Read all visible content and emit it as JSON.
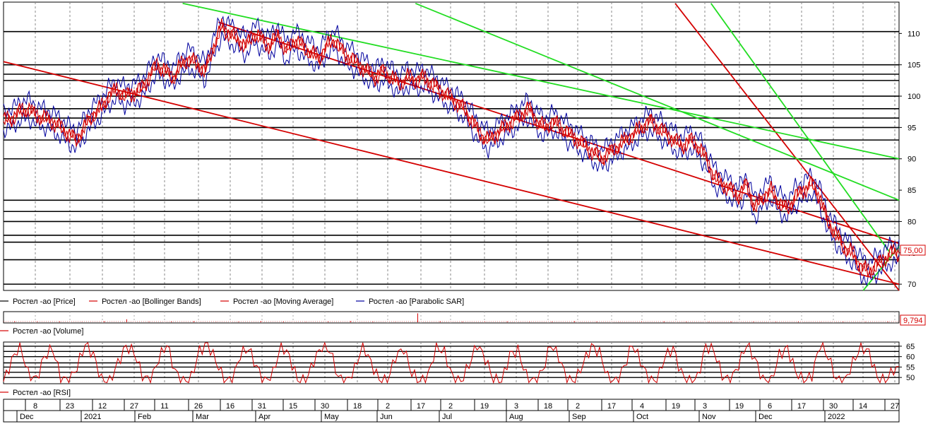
{
  "chart_data": {
    "type": "line",
    "price_panel": {
      "ylim": [
        69,
        115
      ],
      "y_ticks": [
        "70",
        "75",
        "80",
        "85",
        "90",
        "95",
        "100",
        "105",
        "110"
      ],
      "last_value_label": "75,00",
      "legend": [
        {
          "label": "Ростел -ао [Price]",
          "color": "#000000"
        },
        {
          "label": "Ростел -ао [Bollinger Bands]",
          "color": "#d40000"
        },
        {
          "label": "Ростел -ао [Moving Average]",
          "color": "#d40000"
        },
        {
          "label": "Ростел -ао [Parabolic SAR]",
          "color": "#00009e"
        }
      ],
      "horizontal_levels": [
        70,
        73.9,
        76.7,
        77.8,
        80,
        81.6,
        83.4,
        90,
        93,
        95,
        96.5,
        98,
        100,
        102.5,
        103.5,
        105,
        110.3
      ],
      "price_series": [
        96.0,
        96.5,
        97.5,
        98,
        97,
        96.5,
        96,
        95,
        94,
        93,
        95,
        97,
        98,
        100,
        101,
        100,
        100.5,
        101,
        103,
        105,
        104,
        103,
        105,
        106,
        105,
        104,
        108,
        111,
        110,
        109,
        108,
        110,
        109,
        108,
        110,
        107,
        109,
        108,
        107,
        106,
        108,
        109,
        107,
        106,
        105,
        104,
        103,
        104,
        103,
        102,
        103,
        102.5,
        103,
        102,
        101,
        100,
        99,
        98,
        96,
        94,
        93,
        94,
        95,
        96,
        97,
        98,
        96,
        95,
        96,
        95,
        94,
        93,
        92,
        91,
        90,
        91,
        92,
        93,
        94,
        95,
        96,
        95,
        94,
        93,
        92,
        93,
        92,
        90,
        87,
        86,
        85,
        84,
        86,
        82,
        84,
        85,
        83,
        82,
        84,
        85,
        86,
        84,
        80,
        78,
        76,
        75,
        73,
        72,
        73,
        74,
        75
      ],
      "upper_band": [
        97.5,
        98,
        99,
        99.5,
        98.5,
        98,
        97.5,
        96.5,
        95.5,
        94.5,
        96.5,
        98.5,
        99.5,
        101.5,
        102.5,
        101.5,
        102,
        102.5,
        104.5,
        106.5,
        105.5,
        104.5,
        106.5,
        107.5,
        106.5,
        105.5,
        109.5,
        112.5,
        111.5,
        110.5,
        109.5,
        111.5,
        110.5,
        109.5,
        111.5,
        108.5,
        110.5,
        109.5,
        108.5,
        107.5,
        109.5,
        110.5,
        108.5,
        107.5,
        106.5,
        105.5,
        104.5,
        105.5,
        104.5,
        103.5,
        104.5,
        104,
        104.5,
        103.5,
        102.5,
        101.5,
        100.5,
        99.5,
        97.5,
        95.5,
        94.5,
        95.5,
        96.5,
        97.5,
        98.5,
        99.5,
        97.5,
        96.5,
        97.5,
        96.5,
        95.5,
        94.5,
        93.5,
        92.5,
        91.5,
        92.5,
        93.5,
        94.5,
        95.5,
        96.5,
        97.5,
        96.5,
        95.5,
        94.5,
        93.5,
        94.5,
        93.5,
        91.5,
        88.5,
        87.5,
        86.5,
        85.5,
        87.5,
        83.5,
        85.5,
        86.5,
        84.5,
        83.5,
        85.5,
        86.5,
        87.5,
        85.5,
        81.5,
        79.5,
        77.5,
        76.5,
        74.5,
        73.5,
        74.5,
        75.5,
        76.5
      ],
      "lower_band": [
        94.5,
        95,
        96,
        96.5,
        95.5,
        95,
        94.5,
        93.5,
        92.5,
        91.5,
        93.5,
        95.5,
        96.5,
        98.5,
        99.5,
        98.5,
        99,
        99.5,
        101.5,
        103.5,
        102.5,
        101.5,
        103.5,
        104.5,
        103.5,
        102.5,
        106.5,
        109.5,
        108.5,
        107.5,
        106.5,
        108.5,
        107.5,
        106.5,
        108.5,
        105.5,
        107.5,
        106.5,
        105.5,
        104.5,
        106.5,
        107.5,
        105.5,
        104.5,
        103.5,
        102.5,
        101.5,
        102.5,
        101.5,
        100.5,
        101.5,
        101,
        101.5,
        100.5,
        99.5,
        98.5,
        97.5,
        96.5,
        94.5,
        92.5,
        91.5,
        92.5,
        93.5,
        94.5,
        95.5,
        96.5,
        94.5,
        93.5,
        94.5,
        93.5,
        92.5,
        91.5,
        90.5,
        89.5,
        88.5,
        89.5,
        90.5,
        91.5,
        92.5,
        93.5,
        94.5,
        93.5,
        92.5,
        91.5,
        90.5,
        91.5,
        90.5,
        88.5,
        85.5,
        84.5,
        83.5,
        82.5,
        84.5,
        80.5,
        82.5,
        83.5,
        81.5,
        80.5,
        82.5,
        83.5,
        84.5,
        82.5,
        78.5,
        76.5,
        74.5,
        73.5,
        71.5,
        70.5,
        71.5,
        72.5,
        73.5
      ]
    },
    "volume_panel": {
      "legend": [
        {
          "label": "Ростел -ао [Volume]",
          "color": "#d40000"
        }
      ],
      "last_value_label": "9,794",
      "values": [
        0.1,
        0.05,
        0.08,
        0.02,
        0.1,
        0.3,
        0.05,
        0.08,
        0.1,
        0.02,
        0.05,
        0.1,
        0.06,
        0.03,
        0.08,
        0.12,
        0.05,
        0.02,
        0.9,
        0.1,
        0.05,
        0.04,
        0.07,
        0.03,
        0.05,
        0.1,
        0.06,
        0.02,
        0.04,
        0.08,
        0.05,
        0.03,
        0.07,
        0.05,
        0.04,
        0.06,
        0.02,
        0.05,
        0.03,
        0.06
      ]
    },
    "rsi_panel": {
      "legend": [
        {
          "label": "Ростел -ао [RSI]",
          "color": "#d40000"
        }
      ],
      "ylim": [
        47,
        67
      ],
      "y_ticks": [
        "50",
        "55",
        "60",
        "65"
      ],
      "horizontal_levels": [
        50,
        52.5,
        55,
        57,
        60,
        62.5,
        65
      ],
      "values": [
        48,
        58,
        66,
        52,
        49,
        60,
        64,
        50,
        48,
        55,
        66,
        61,
        49,
        48,
        57,
        65,
        62,
        51,
        48,
        59,
        66,
        53,
        48,
        50,
        63,
        66,
        58,
        49,
        48,
        61,
        64,
        55,
        48,
        52,
        66,
        60,
        49,
        48,
        58,
        65,
        63,
        50,
        48,
        54,
        66,
        57,
        49,
        48,
        60,
        64,
        52,
        48,
        51,
        65,
        62,
        50,
        48,
        56,
        66,
        59,
        49,
        48,
        61,
        63,
        51,
        48,
        53,
        66,
        60,
        49,
        48,
        57,
        65,
        62,
        50,
        48,
        55,
        66,
        58,
        49,
        48,
        60,
        64,
        52,
        48,
        50,
        65,
        63,
        51,
        48,
        56,
        66,
        59,
        49,
        48,
        61,
        64,
        53,
        48,
        51,
        66,
        60,
        49,
        48,
        57,
        65,
        62,
        50,
        48,
        54
      ]
    },
    "x_axis": {
      "day_ticks": [
        "8",
        "23",
        "12",
        "27",
        "11",
        "26",
        "16",
        "31",
        "15",
        "30",
        "18",
        "2",
        "17",
        "2",
        "19",
        "3",
        "18",
        "2",
        "17",
        "4",
        "19",
        "3",
        "19",
        "6",
        "17",
        "30",
        "14",
        "27"
      ],
      "month_ticks": [
        "Dec",
        "2021",
        "Feb",
        "Mar",
        "Apr",
        "May",
        "Jun",
        "Jul",
        "Aug",
        "Sep",
        "Oct",
        "Nov",
        "Dec",
        "2022"
      ]
    },
    "trend_lines": [
      {
        "color": "#d40000",
        "from": [
          0,
          105.5
        ],
        "to": [
          1,
          70
        ]
      },
      {
        "color": "#d40000",
        "from": [
          0.24,
          111.8
        ],
        "to": [
          1,
          76.5
        ]
      },
      {
        "color": "#d40000",
        "from": [
          0.75,
          114.8
        ],
        "to": [
          1,
          69
        ]
      },
      {
        "color": "#22dd22",
        "from": [
          0.2,
          114.8
        ],
        "to": [
          1,
          90
        ]
      },
      {
        "color": "#22dd22",
        "from": [
          0.46,
          114.8
        ],
        "to": [
          1,
          83.4
        ]
      },
      {
        "color": "#22dd22",
        "from": [
          0.79,
          114.8
        ],
        "to": [
          0.99,
          75
        ]
      },
      {
        "color": "#22dd22",
        "from": [
          0.96,
          69
        ],
        "to": [
          1,
          76
        ]
      }
    ]
  }
}
